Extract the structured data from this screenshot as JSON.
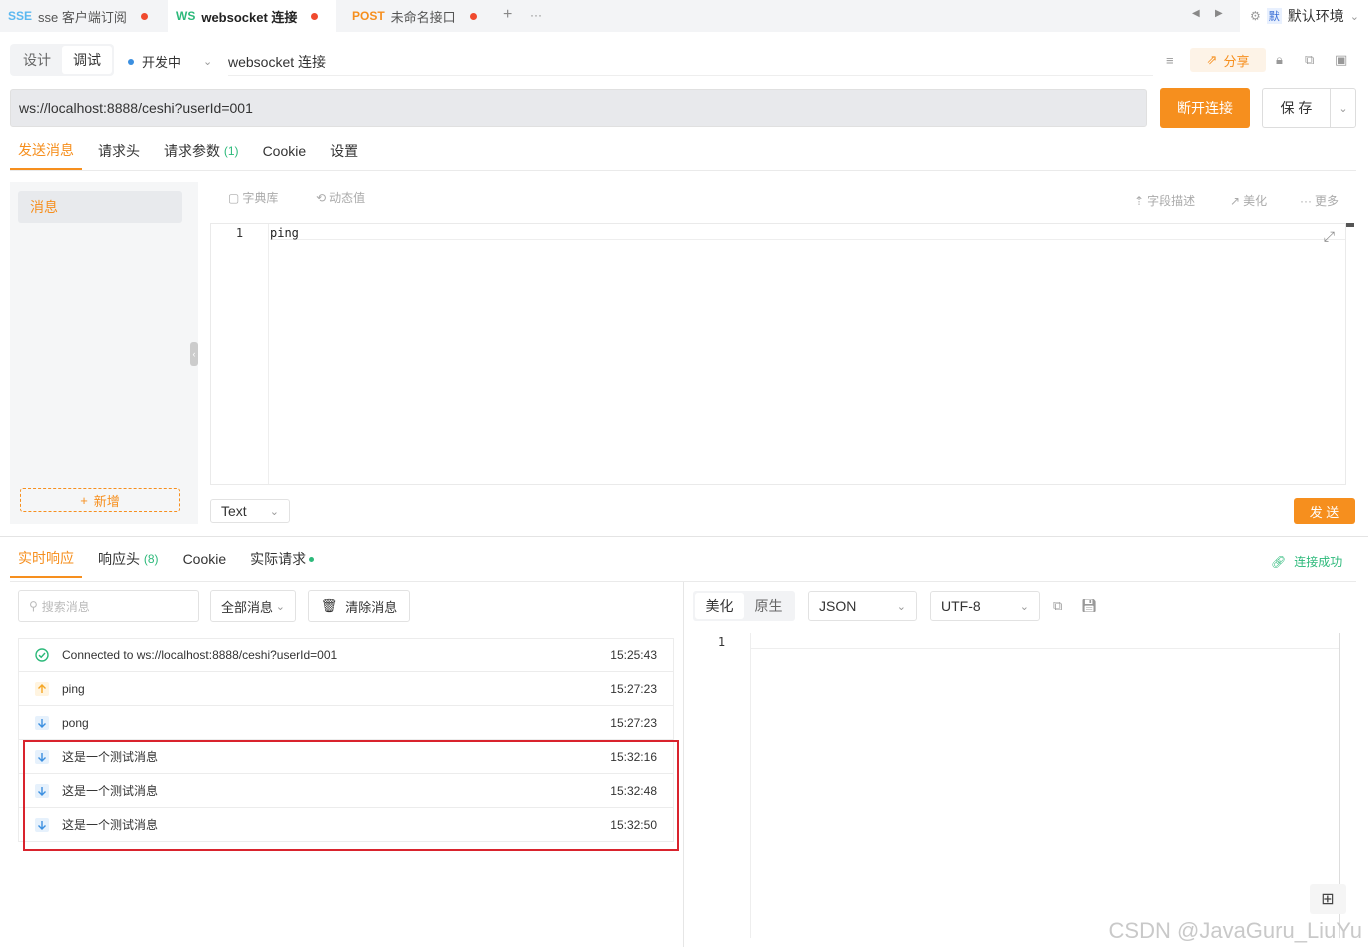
{
  "tabs": [
    {
      "method": "SSE",
      "method_color": "#5bb8f0",
      "label": "sse 客户端订阅"
    },
    {
      "method": "WS",
      "method_color": "#2cb97a",
      "label": "websocket 连接"
    },
    {
      "method": "POST",
      "method_color": "#f68f1e",
      "label": "未命名接口"
    }
  ],
  "tab_add": "+",
  "tab_more": "···",
  "environment": {
    "badge": "默",
    "label": "默认环境"
  },
  "toolbar": {
    "mode_design": "设计",
    "mode_debug": "调试",
    "status": "开发中",
    "name": "websocket 连接",
    "share": "分享"
  },
  "url": "ws://localhost:8888/ceshi?userId=001",
  "disconnect_button": "断开连接",
  "save_button": "保 存",
  "request_tabs": [
    {
      "label": "发送消息"
    },
    {
      "label": "请求头"
    },
    {
      "label": "请求参数",
      "count": "(1)"
    },
    {
      "label": "Cookie"
    },
    {
      "label": "设置"
    }
  ],
  "sidebar": {
    "item": "消息",
    "add": "新增"
  },
  "editor_tools": {
    "dict": "字典库",
    "dynamic": "动态值",
    "field_desc": "字段描述",
    "beautify": "美化",
    "more": "更多"
  },
  "editor": {
    "line": "1",
    "code": "ping"
  },
  "format_select": "Text",
  "send_button": "发 送",
  "response_tabs": [
    {
      "label": "实时响应"
    },
    {
      "label": "响应头",
      "count": "(8)"
    },
    {
      "label": "Cookie"
    },
    {
      "label": "实际请求"
    }
  ],
  "connection_status": "连接成功",
  "search_placeholder": "搜索消息",
  "filter_select": "全部消息",
  "clear_button": "清除消息",
  "messages": [
    {
      "type": "connected",
      "text": "Connected to ws://localhost:8888/ceshi?userId=001",
      "time": "15:25:43"
    },
    {
      "type": "sent",
      "text": "ping",
      "time": "15:27:23"
    },
    {
      "type": "received",
      "text": "pong",
      "time": "15:27:23"
    },
    {
      "type": "received",
      "text": "这是一个测试消息",
      "time": "15:32:16"
    },
    {
      "type": "received",
      "text": "这是一个测试消息",
      "time": "15:32:48"
    },
    {
      "type": "received",
      "text": "这是一个测试消息",
      "time": "15:32:50"
    }
  ],
  "response": {
    "mode_beautify": "美化",
    "mode_raw": "原生",
    "format": "JSON",
    "encoding": "UTF-8",
    "line": "1"
  },
  "watermark": "CSDN @JavaGuru_LiuYu",
  "colors": {
    "accent": "#f68f1e",
    "success": "#2cb97a",
    "info": "#3b8fe0",
    "highlight_box": "#d9232d"
  }
}
